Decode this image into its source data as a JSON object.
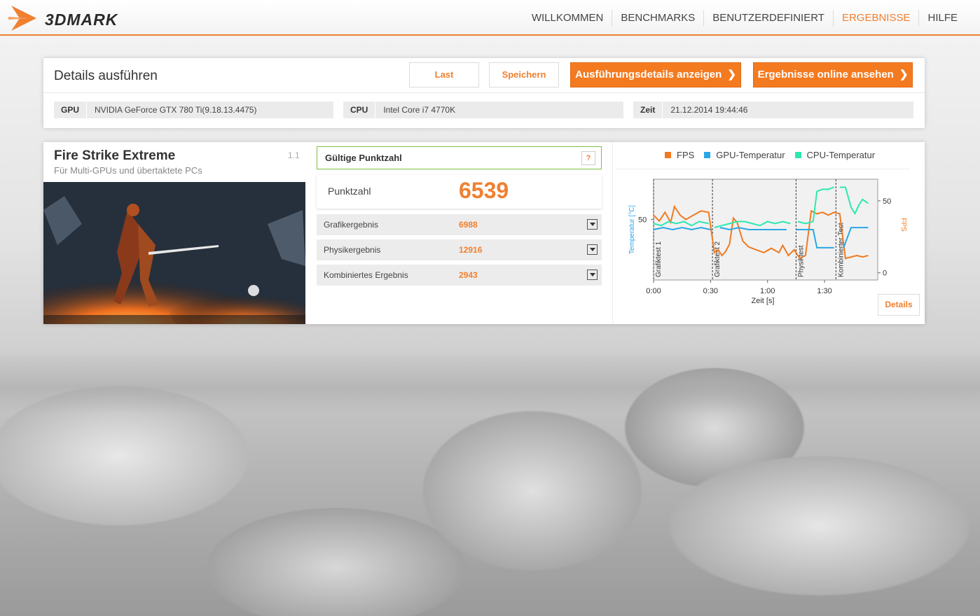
{
  "app": {
    "logo_text": "3DMARK"
  },
  "nav": {
    "items": [
      {
        "label": "WILLKOMMEN"
      },
      {
        "label": "BENCHMARKS"
      },
      {
        "label": "BENUTZERDEFINIERT"
      },
      {
        "label": "ERGEBNISSE"
      },
      {
        "label": "HILFE"
      }
    ],
    "active": "ERGEBNISSE"
  },
  "details": {
    "title": "Details ausführen",
    "buttons": {
      "load": "Last",
      "save": "Speichern",
      "show_details": "Ausführungsdetails anzeigen",
      "view_online": "Ergebnisse online ansehen"
    },
    "gpu": {
      "key": "GPU",
      "value": "NVIDIA GeForce GTX 780 Ti(9.18.13.4475)"
    },
    "cpu": {
      "key": "CPU",
      "value": "Intel Core i7 4770K"
    },
    "time": {
      "key": "Zeit",
      "value": "21.12.2014 19:44:46"
    }
  },
  "benchmark": {
    "name": "Fire Strike Extreme",
    "subtitle": "Für Multi-GPUs und übertaktete PCs",
    "version": "1.1",
    "valid_label": "Gültige Punktzahl",
    "help": "?",
    "score_label": "Punktzahl",
    "score": "6539",
    "sub_scores": [
      {
        "label": "Grafikergebnis",
        "value": "6988"
      },
      {
        "label": "Physikergebnis",
        "value": "12916"
      },
      {
        "label": "Kombiniertes Ergebnis",
        "value": "2943"
      }
    ],
    "details_button": "Details"
  },
  "colors": {
    "accent": "#f08030",
    "fps": "#f07a20",
    "gpu_temp": "#2aa6e6",
    "cpu_temp": "#2ee8b0",
    "valid": "#7ec13f"
  },
  "chart_data": {
    "type": "line",
    "xlabel": "Zeit [s]",
    "ylabel_left": "Temperatur [°C]",
    "ylabel_right": "FPS",
    "x_ticks": [
      "0:00",
      "0:30",
      "1:00",
      "1:30"
    ],
    "y_left_ticks": [
      "50"
    ],
    "y_right_ticks": [
      "50",
      "0"
    ],
    "sections": [
      "Grafiktest 1",
      "Grafiktest 2",
      "Physiktest",
      "Kombinierter Test"
    ],
    "series": [
      {
        "name": "FPS",
        "color": "#f07a20",
        "axis": "right",
        "x": [
          0,
          3,
          6,
          9,
          11,
          14,
          17,
          21,
          25,
          29,
          32,
          34,
          36,
          38,
          40,
          42,
          44,
          47,
          50,
          54,
          58,
          62,
          66,
          68,
          71,
          74,
          77,
          80,
          83,
          86,
          89,
          92,
          95,
          98,
          101,
          104,
          107,
          110,
          113
        ],
        "y": [
          40,
          36,
          42,
          35,
          46,
          40,
          37,
          40,
          43,
          42,
          14,
          16,
          12,
          15,
          20,
          38,
          35,
          22,
          18,
          16,
          14,
          17,
          14,
          19,
          12,
          16,
          10,
          12,
          43,
          41,
          42,
          40,
          42,
          41,
          10,
          11,
          12,
          11,
          12
        ]
      },
      {
        "name": "GPU-Temperatur",
        "color": "#2aa6e6",
        "axis": "left",
        "x": [
          0,
          5,
          10,
          15,
          20,
          25,
          30,
          35,
          40,
          45,
          50,
          55,
          60,
          65,
          70,
          75,
          80,
          84,
          86,
          90,
          95,
          100,
          104,
          107,
          110,
          113
        ],
        "y": [
          45,
          46,
          45,
          46,
          45,
          46,
          45,
          46,
          45,
          46,
          45,
          45,
          45,
          45,
          45,
          45,
          45,
          45,
          36,
          36,
          36,
          36,
          46,
          46,
          46,
          46
        ]
      },
      {
        "name": "CPU-Temperatur",
        "color": "#2ee8b0",
        "axis": "left",
        "x": [
          0,
          4,
          8,
          12,
          16,
          20,
          24,
          29,
          32,
          36,
          40,
          44,
          48,
          52,
          56,
          60,
          64,
          68,
          72,
          76,
          80,
          84,
          86,
          89,
          92,
          95,
          98,
          101,
          104,
          106,
          108,
          110,
          113
        ],
        "y": [
          48,
          47,
          49,
          48,
          49,
          47,
          49,
          48,
          46,
          47,
          48,
          49,
          49,
          48,
          47,
          49,
          48,
          49,
          48,
          49,
          48,
          49,
          64,
          65,
          65,
          66,
          66,
          66,
          56,
          53,
          57,
          60,
          58
        ]
      }
    ]
  }
}
